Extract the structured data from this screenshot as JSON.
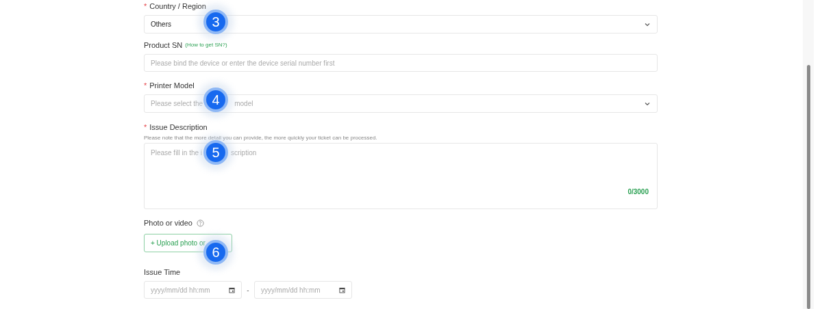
{
  "country_region": {
    "label": "Country / Region",
    "required": true,
    "required_mark": "*",
    "value": "Others",
    "marker": "3"
  },
  "product_sn": {
    "label": "Product SN",
    "help_link": "(How to get SN?)",
    "placeholder": "Please bind the device or enter the device serial number first"
  },
  "printer_model": {
    "label": "Printer Model",
    "required": true,
    "required_mark": "*",
    "placeholder_parts": [
      "Please select the",
      "model"
    ],
    "marker": "4"
  },
  "issue_description": {
    "label": "Issue Description",
    "required": true,
    "required_mark": "*",
    "note": "Please note that the more detail you can provide, the more quickly your ticket can be processed.",
    "placeholder_parts": [
      "Please fill in the i",
      "scription"
    ],
    "counter": "0/3000",
    "marker": "5"
  },
  "photo_or_video": {
    "label": "Photo or video",
    "upload_button": "+ Upload photo or",
    "marker": "6"
  },
  "issue_time": {
    "label": "Issue Time",
    "start_placeholder": "yyyy/mm/dd hh:mm",
    "separator": "-",
    "end_placeholder": "yyyy/mm/dd hh:mm"
  }
}
